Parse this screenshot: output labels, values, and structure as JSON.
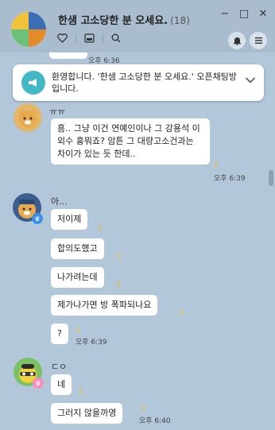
{
  "room": {
    "title": "한샘 고소당한 분 오세요.",
    "count": "(18)"
  },
  "window_controls": {
    "minimize": "−",
    "maximize": "□",
    "close": "✕"
  },
  "icons": {
    "heart": "heart-icon",
    "album": "album-icon",
    "search": "search-icon",
    "bell": "bell-icon",
    "menu": "menu-icon",
    "megaphone": "megaphone-icon",
    "chevron": "chevron-down-icon"
  },
  "peek": {
    "time": "오후 6:36"
  },
  "notice": {
    "text": "환영합니다. '한샘 고소당한 분 오세요.' 오픈채팅방입니다."
  },
  "messages": [
    {
      "sender": "ㅠㅠ",
      "bubbles": [
        {
          "text": "흠.. 그냥 이건 연예인이나 그 강용석 이외수 홍뭐죠? 암튼 그 대량고소건과는 차이가 있는 듯 한데..",
          "unread": "2",
          "time": "오후 6:39"
        }
      ]
    },
    {
      "sender": "아...",
      "bubbles": [
        {
          "text": "저이제",
          "unread": "2"
        },
        {
          "text": "합의도했고",
          "unread": "2"
        },
        {
          "text": "나가려는데",
          "unread": "2"
        },
        {
          "text": "제가나가면 방 폭파되나요",
          "unread": "2"
        },
        {
          "text": "?",
          "unread": "2",
          "time": "오후 6:39"
        }
      ]
    },
    {
      "sender": "ㄷㅇ",
      "bubbles": [
        {
          "text": "네",
          "unread": "2"
        },
        {
          "text": "그러지 않을까영",
          "unread": "2",
          "time": "오후 6:40"
        }
      ]
    }
  ],
  "colors": {
    "background": "#b2c7d9",
    "header": "#a9bdce",
    "notice_icon": "#41b8c4",
    "unread": "#e6c02b"
  }
}
